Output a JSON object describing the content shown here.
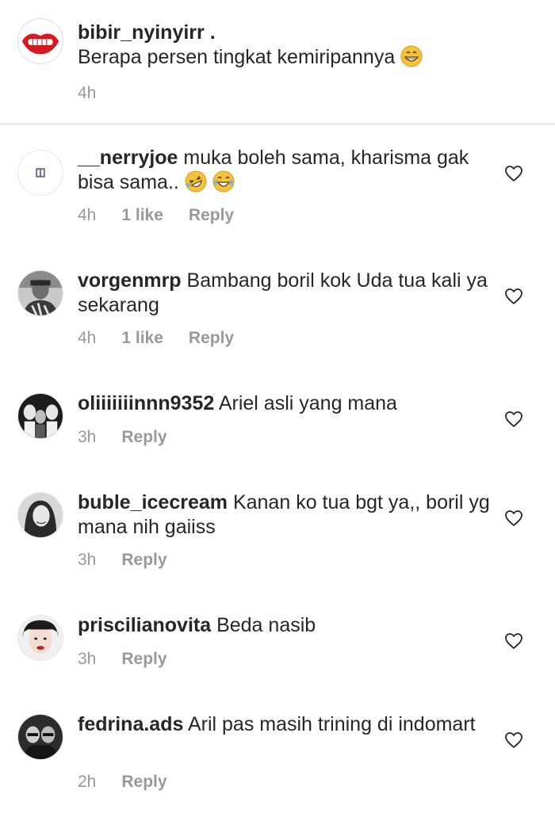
{
  "caption": {
    "username": "bibir_nyinyirr .",
    "text": "Berapa persen tingkat kemiripannya",
    "time": "4h"
  },
  "comments": [
    {
      "username": "__nerryjoe",
      "text": "muka boleh sama, kharisma gak bisa sama..",
      "time": "4h",
      "likes": "1 like",
      "reply": "Reply"
    },
    {
      "username": "vorgenmrp",
      "text": "Bambang boril kok Uda tua kali ya sekarang",
      "time": "4h",
      "likes": "1 like",
      "reply": "Reply"
    },
    {
      "username": "oliiiiiiinnn9352",
      "text": "Ariel asli yang mana",
      "time": "3h",
      "reply": "Reply"
    },
    {
      "username": "buble_icecream",
      "text": "Kanan ko tua bgt ya,, boril yg mana nih gaiiss",
      "time": "3h",
      "reply": "Reply"
    },
    {
      "username": "priscilianovita",
      "text": "Beda nasib",
      "time": "3h",
      "reply": "Reply"
    },
    {
      "username": "fedrina.ads",
      "text": "Aril pas masih trining di indomart",
      "time": "2h",
      "reply": "Reply"
    }
  ],
  "icons": {
    "like": "heart-outline-icon",
    "emoji_grin": "grinning-face-emoji",
    "emoji_rofl": "rolling-on-floor-laughing-emoji",
    "emoji_tears": "tears-of-joy-emoji"
  },
  "colors": {
    "text": "#262626",
    "meta": "#999999",
    "divider": "#dbdbdb"
  }
}
